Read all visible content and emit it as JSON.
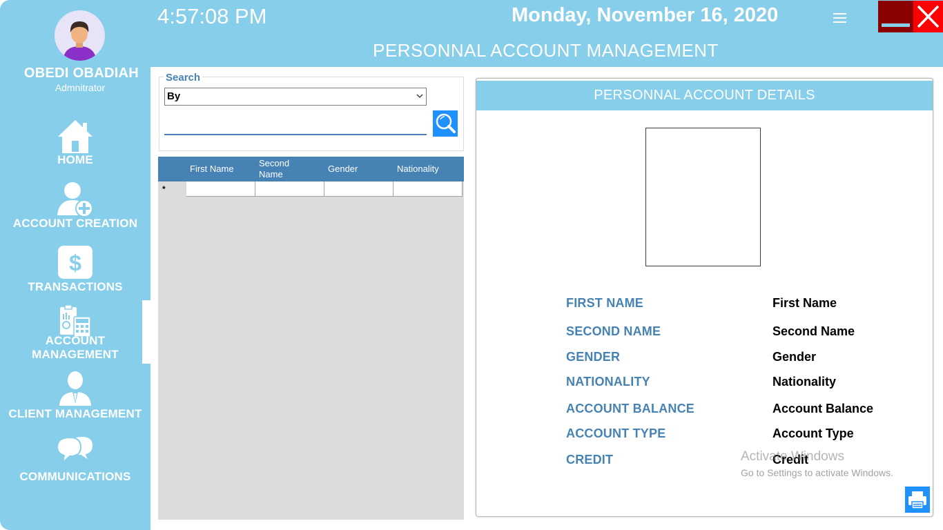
{
  "topbar": {
    "time": "4:57:08 PM",
    "date": "Monday, November 16, 2020",
    "page_title": "PERSONNAL ACCOUNT MANAGEMENT",
    "menu_icon": "hamburger-menu-icon",
    "minimize_icon": "minimize-icon",
    "close_icon": "close-icon"
  },
  "user": {
    "name": "OBEDI OBADIAH",
    "role": "Admnitrator"
  },
  "sidebar": {
    "items": [
      {
        "label": "HOME",
        "icon": "home-icon"
      },
      {
        "label": "ACCOUNT CREATION",
        "icon": "add-user-icon"
      },
      {
        "label": "TRANSACTIONS",
        "icon": "dollar-icon"
      },
      {
        "label_line1": "ACCOUNT",
        "label_line2": "MANAGEMENT",
        "icon": "accounting-icon",
        "active": true
      },
      {
        "label": "CLIENT MANAGEMENT",
        "icon": "client-icon"
      },
      {
        "label": "COMMUNICATIONS",
        "icon": "chat-icon"
      }
    ]
  },
  "search": {
    "legend": "Search",
    "by_value": "By",
    "input_value": "",
    "button_icon": "search-icon"
  },
  "grid": {
    "columns": [
      "First Name",
      "Second Name",
      "Gender",
      "Nationality"
    ],
    "new_row_marker": "*"
  },
  "details": {
    "header": "PERSONNAL ACCOUNT DETAILS",
    "fields": [
      {
        "label": "FIRST NAME",
        "value": "First Name"
      },
      {
        "label": "SECOND NAME",
        "value": "Second Name"
      },
      {
        "label": "GENDER",
        "value": "Gender"
      },
      {
        "label": "NATIONALITY",
        "value": "Nationality"
      },
      {
        "label": "ACCOUNT BALANCE",
        "value": "Account Balance"
      },
      {
        "label": "ACCOUNT TYPE",
        "value": "Account Type"
      },
      {
        "label": "CREDIT",
        "value": "Credit"
      }
    ],
    "print_icon": "printer-icon"
  },
  "watermark": {
    "title": "Activate Windows",
    "subtitle": "Go to Settings to activate Windows."
  },
  "colors": {
    "sky": "#87ceeb",
    "steel_blue": "#4682b4",
    "button_blue": "#1e90ff",
    "close_red": "#ff0000",
    "minimize_dark_red": "#8b0000"
  }
}
